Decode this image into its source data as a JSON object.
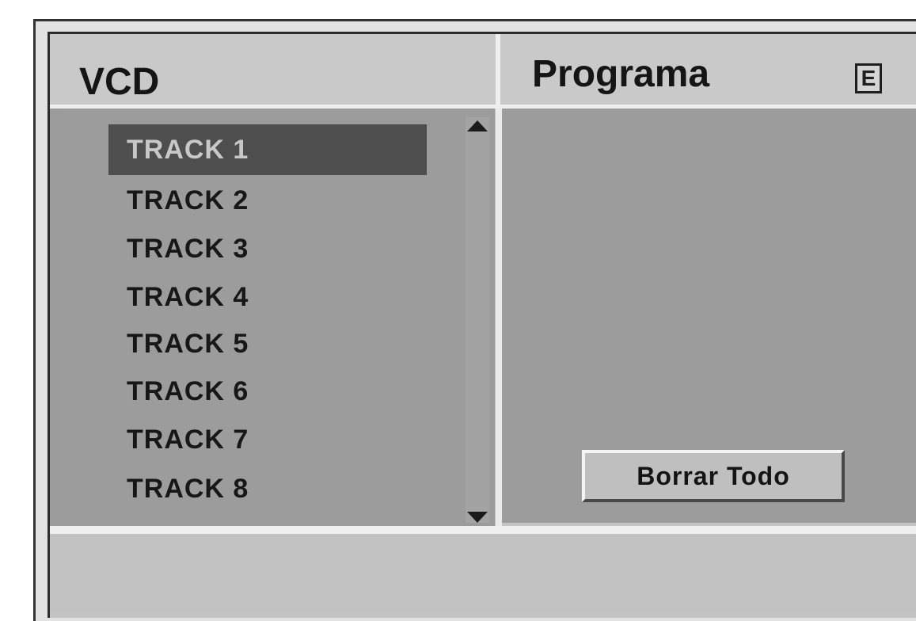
{
  "left_panel": {
    "title": "VCD",
    "tracks": [
      {
        "label": "TRACK 1",
        "selected": true
      },
      {
        "label": "TRACK 2",
        "selected": false
      },
      {
        "label": "TRACK 3",
        "selected": false
      },
      {
        "label": "TRACK 4",
        "selected": false
      },
      {
        "label": "TRACK 5",
        "selected": false
      },
      {
        "label": "TRACK 6",
        "selected": false
      },
      {
        "label": "TRACK 7",
        "selected": false
      },
      {
        "label": "TRACK 8",
        "selected": false
      }
    ]
  },
  "right_panel": {
    "title": "Programa",
    "badge": "E",
    "clear_all_label": "Borrar Todo"
  },
  "icons": {
    "scroll_up": "scroll-up-arrow-icon",
    "scroll_down": "scroll-down-arrow-icon"
  }
}
